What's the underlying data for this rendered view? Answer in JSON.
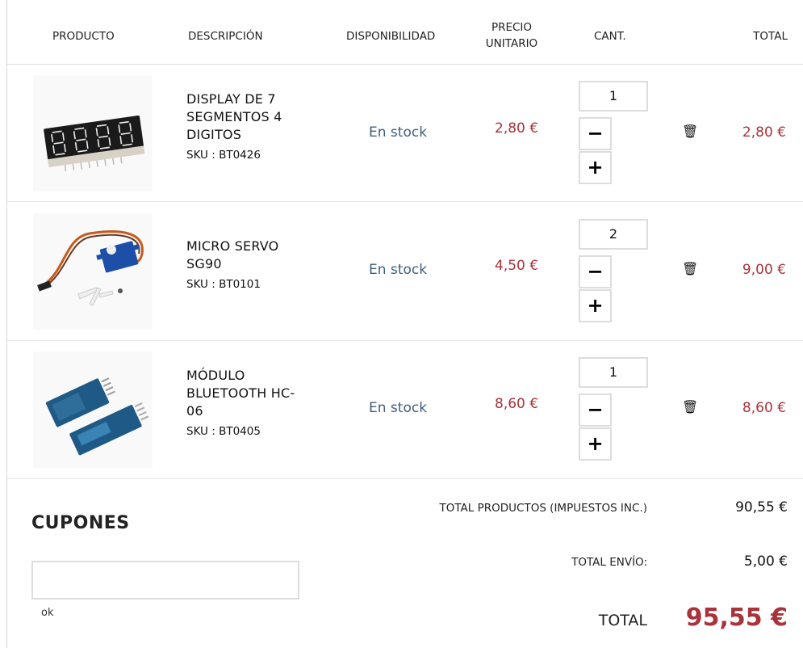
{
  "table_header": {
    "product": "PRODUCTO",
    "description": "DESCRIPCIÓN",
    "availability": "DISPONIBILIDAD",
    "unit_price": "PRECIO UNITARIO",
    "quantity": "CANT.",
    "total": "TOTAL"
  },
  "items": [
    {
      "name": "DISPLAY DE 7 SEGMENTOS 4 DIGITOS",
      "sku": "SKU : BT0426",
      "availability": "En stock",
      "unit_price": "2,80 €",
      "quantity": "1",
      "line_total": "2,80 €",
      "image_icon": "seven-segment-display-icon"
    },
    {
      "name": "MICRO SERVO SG90",
      "sku": "SKU : BT0101",
      "availability": "En stock",
      "unit_price": "4,50 €",
      "quantity": "2",
      "line_total": "9,00 €",
      "image_icon": "micro-servo-icon"
    },
    {
      "name": "MÓDULO BLUETOOTH HC-06",
      "sku": "SKU : BT0405",
      "availability": "En stock",
      "unit_price": "8,60 €",
      "quantity": "1",
      "line_total": "8,60 €",
      "image_icon": "bluetooth-module-icon"
    }
  ],
  "controls": {
    "minus": "−",
    "plus": "+",
    "trash": "🗑"
  },
  "coupons": {
    "title": "CUPONES",
    "input_value": "",
    "ok_label": "ok"
  },
  "summary": {
    "products_label": "TOTAL PRODUCTOS (IMPUESTOS INC.)",
    "products_value": "90,55 €",
    "shipping_label": "TOTAL ENVÍO:",
    "shipping_value": "5,00 €",
    "total_label": "TOTAL",
    "total_value": "95,55 €"
  },
  "colors": {
    "price": "#a9333a",
    "stock": "#3f5f7f",
    "border": "#dddddd"
  }
}
